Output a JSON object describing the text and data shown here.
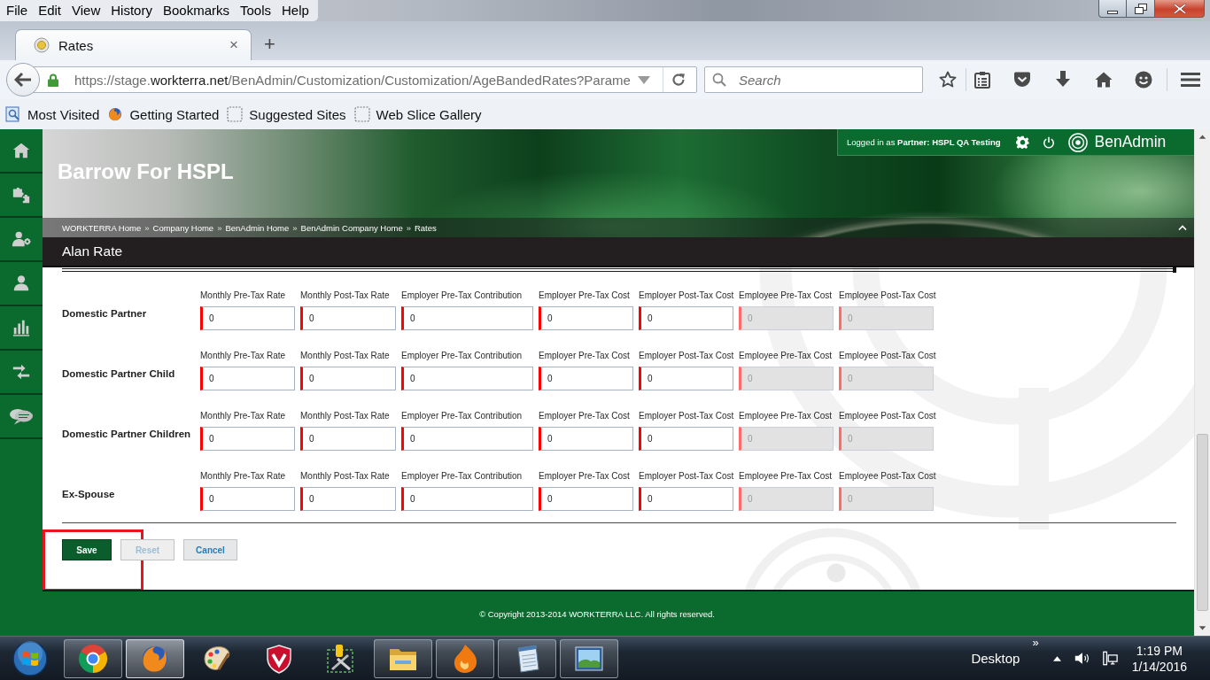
{
  "browser": {
    "menu": [
      "File",
      "Edit",
      "View",
      "History",
      "Bookmarks",
      "Tools",
      "Help"
    ],
    "tabs": [
      {
        "title": "Rates",
        "selected": true,
        "close": "×"
      }
    ],
    "new_tab": "+",
    "url": {
      "start": "https://stage.",
      "domain": "workterra.net",
      "end": "/BenAdmin/Customization/Customization/AgeBandedRates?Parame"
    },
    "search": {
      "placeholder": "Search"
    },
    "bookmarks": [
      {
        "label": "Most Visited",
        "kind": "most-visited"
      },
      {
        "label": "Getting Started",
        "kind": "fox"
      },
      {
        "label": "Suggested Sites",
        "kind": "slice"
      },
      {
        "label": "Web Slice Gallery",
        "kind": "slice"
      }
    ]
  },
  "sidebar": {
    "items": [
      {
        "kind": "home"
      },
      {
        "kind": "puzzle"
      },
      {
        "kind": "person-gear"
      },
      {
        "kind": "person"
      },
      {
        "kind": "chart"
      },
      {
        "kind": "arrows"
      },
      {
        "kind": "chat"
      }
    ]
  },
  "header": {
    "login": "Logged in as **Partner:** **HSPL QA Testing**",
    "brand": "BenAdmin",
    "site_title": "Barrow For HSPL",
    "breadcrumb": {
      "separator": "»",
      "items": [
        "WORKTERRA Home",
        "Company Home",
        "BenAdmin Home",
        "BenAdmin Company Home",
        "Rates"
      ]
    }
  },
  "page_title": "Alan Rate",
  "rate_rows": [
    {
      "label": "Domestic Partner",
      "fields": [
        {
          "label": "Monthly Pre-Tax Rate",
          "value": "0",
          "disabled": false
        },
        {
          "label": "Monthly Post-Tax Rate",
          "value": "0",
          "disabled": false
        },
        {
          "label": "Employer Pre-Tax Contribution",
          "value": "0",
          "disabled": false
        },
        {
          "label": "Employer Pre-Tax Cost",
          "value": "0",
          "disabled": false
        },
        {
          "label": "Employer Post-Tax Cost",
          "value": "0",
          "disabled": false
        },
        {
          "label": "Employee Pre-Tax Cost",
          "value": "0",
          "disabled": true
        },
        {
          "label": "Employee Post-Tax Cost",
          "value": "0",
          "disabled": true
        }
      ]
    },
    {
      "label": "Domestic Partner Child",
      "fields": [
        {
          "label": "Monthly Pre-Tax Rate",
          "value": "0",
          "disabled": false
        },
        {
          "label": "Monthly Post-Tax Rate",
          "value": "0",
          "disabled": false
        },
        {
          "label": "Employer Pre-Tax Contribution",
          "value": "0",
          "disabled": false
        },
        {
          "label": "Employer Pre-Tax Cost",
          "value": "0",
          "disabled": false
        },
        {
          "label": "Employer Post-Tax Cost",
          "value": "0",
          "disabled": false
        },
        {
          "label": "Employee Pre-Tax Cost",
          "value": "0",
          "disabled": true
        },
        {
          "label": "Employee Post-Tax Cost",
          "value": "0",
          "disabled": true
        }
      ]
    },
    {
      "label": "Domestic Partner Children",
      "fields": [
        {
          "label": "Monthly Pre-Tax Rate",
          "value": "0",
          "disabled": false
        },
        {
          "label": "Monthly Post-Tax Rate",
          "value": "0",
          "disabled": false
        },
        {
          "label": "Employer Pre-Tax Contribution",
          "value": "0",
          "disabled": false
        },
        {
          "label": "Employer Pre-Tax Cost",
          "value": "0",
          "disabled": false
        },
        {
          "label": "Employer Post-Tax Cost",
          "value": "0",
          "disabled": false
        },
        {
          "label": "Employee Pre-Tax Cost",
          "value": "0",
          "disabled": true
        },
        {
          "label": "Employee Post-Tax Cost",
          "value": "0",
          "disabled": true
        }
      ]
    },
    {
      "label": "Ex-Spouse",
      "fields": [
        {
          "label": "Monthly Pre-Tax Rate",
          "value": "0",
          "disabled": false
        },
        {
          "label": "Monthly Post-Tax Rate",
          "value": "0",
          "disabled": false
        },
        {
          "label": "Employer Pre-Tax Contribution",
          "value": "0",
          "disabled": false
        },
        {
          "label": "Employer Pre-Tax Cost",
          "value": "0",
          "disabled": false
        },
        {
          "label": "Employer Post-Tax Cost",
          "value": "0",
          "disabled": false
        },
        {
          "label": "Employee Pre-Tax Cost",
          "value": "0",
          "disabled": true
        },
        {
          "label": "Employee Post-Tax Cost",
          "value": "0",
          "disabled": true
        }
      ]
    }
  ],
  "buttons": [
    {
      "label": "Save",
      "kind": "primary",
      "disabled": false,
      "highlighted": true
    },
    {
      "label": "Reset",
      "kind": "secondary",
      "disabled": true,
      "highlighted": false
    },
    {
      "label": "Cancel",
      "kind": "secondary",
      "disabled": false,
      "highlighted": false
    }
  ],
  "footer": "© Copyright 2013-2014 WORKTERRA LLC. All rights reserved.",
  "taskbar": {
    "apps": [
      {
        "kind": "chrome",
        "running": true,
        "active": false
      },
      {
        "kind": "firefox",
        "running": true,
        "active": true
      },
      {
        "kind": "paint",
        "running": false,
        "active": false
      },
      {
        "kind": "antivirus",
        "running": false,
        "active": false
      },
      {
        "kind": "tools",
        "running": false,
        "active": false
      },
      {
        "kind": "explorer",
        "running": true,
        "active": false
      },
      {
        "kind": "flame",
        "running": true,
        "active": false
      },
      {
        "kind": "notepad",
        "running": true,
        "active": false
      },
      {
        "kind": "photos",
        "running": true,
        "active": false
      }
    ],
    "toolbar": "Desktop",
    "toolbar_more": "»",
    "time": "1:19 PM",
    "date": "1/14/2016"
  }
}
